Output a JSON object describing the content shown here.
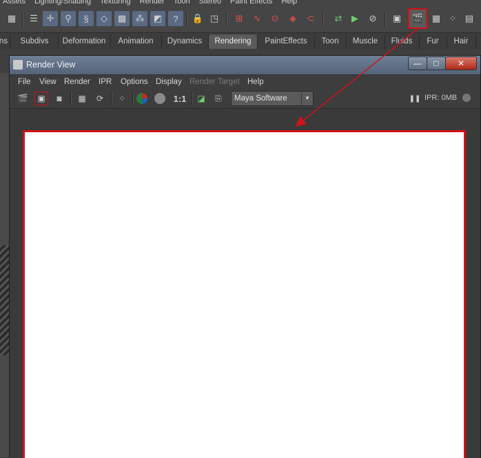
{
  "main_menu": [
    "Assets",
    "Lighting/Shading",
    "Texturing",
    "Render",
    "Toon",
    "Stereo",
    "Paint Effects",
    "Help"
  ],
  "shelf_tabs": [
    {
      "label": "ns",
      "active": false
    },
    {
      "label": "Subdivs",
      "active": false
    },
    {
      "label": "Deformation",
      "active": false
    },
    {
      "label": "Animation",
      "active": false
    },
    {
      "label": "Dynamics",
      "active": false
    },
    {
      "label": "Rendering",
      "active": true
    },
    {
      "label": "PaintEffects",
      "active": false
    },
    {
      "label": "Toon",
      "active": false
    },
    {
      "label": "Muscle",
      "active": false
    },
    {
      "label": "Fluids",
      "active": false
    },
    {
      "label": "Fur",
      "active": false
    },
    {
      "label": "Hair",
      "active": false
    }
  ],
  "render_view": {
    "title": "Render View",
    "menu": [
      "File",
      "View",
      "Render",
      "IPR",
      "Options",
      "Display",
      "Render Target",
      "Help"
    ],
    "disabled_menu": [
      "Render Target"
    ],
    "toolbar": {
      "ratio_label": "1:1",
      "renderer": "Maya Software",
      "ipr_status": "IPR: 0MB"
    },
    "window_controls": {
      "minimize": "—",
      "maximize": "□",
      "close": "✕"
    }
  },
  "icons": [
    "render-frame-icon",
    "ipr-render-icon",
    "snapshot-icon",
    "render-region-icon",
    "refresh-icon",
    "keep-image-icon",
    "color-channels-icon",
    "alpha-channel-icon",
    "real-size-icon",
    "display-icon",
    "render-settings-icon",
    "pause-icon"
  ],
  "accent_colors": {
    "highlight": "#d0121a",
    "title_bar": "#5f6e84"
  }
}
